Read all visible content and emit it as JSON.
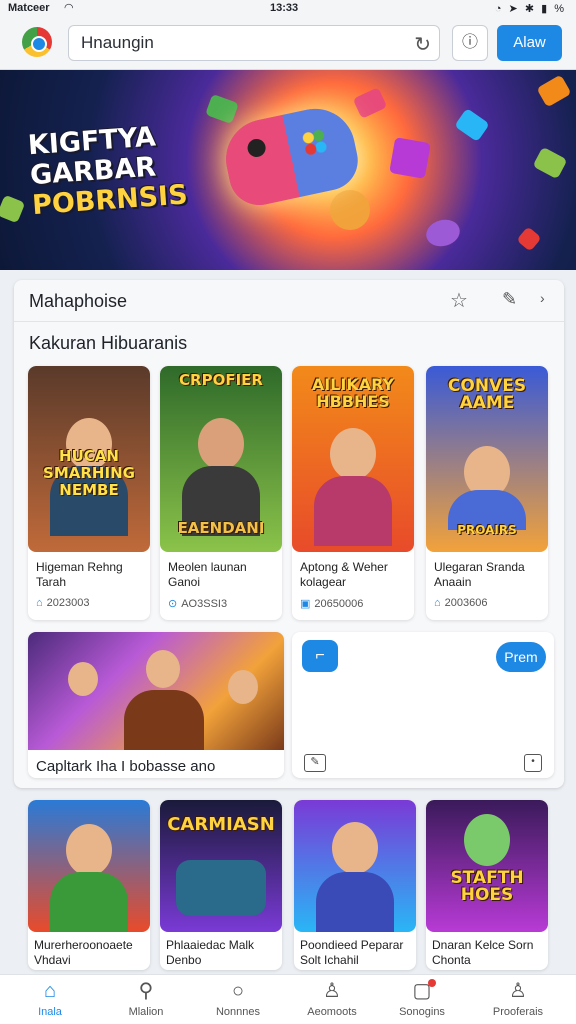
{
  "status": {
    "carrier": "Matceer",
    "time": "13:33",
    "icons": "◔ ➤ ✱ ▮ %"
  },
  "browser": {
    "url_value": "Hnaungin",
    "allow_label": "Alaw"
  },
  "hero": {
    "line1": "KIGFTYA",
    "line2": "GARBAR",
    "line3": "POBRNSIS"
  },
  "panel": {
    "title": "Mahaphoise",
    "section_title": "Kakuran Hibuaranis",
    "cards": [
      {
        "art_text": "HUCAN SMARHING NEMBE",
        "name": "Higeman Rehng Tarah",
        "meta": "2023003",
        "colors": [
          "#5a3a2a",
          "#c06a3a"
        ]
      },
      {
        "art_text": "CRPOFIER",
        "art_text2": "EAENDANI",
        "name": "Meolen launan Ganoi",
        "meta": "AO3SSI3",
        "colors": [
          "#2f6a2a",
          "#8bc34a"
        ]
      },
      {
        "art_text": "AILIKARY HBBHES",
        "name": "Aptong & Weher kolagear",
        "meta": "20650006",
        "colors": [
          "#f28a1a",
          "#e84b2a"
        ]
      },
      {
        "art_text": "CONVES AAME",
        "art_text2": "PROAIRS",
        "name": "Ulegaran Sranda Anaain",
        "meta": "2003606",
        "colors": [
          "#3a5ad6",
          "#f2a23a"
        ]
      }
    ],
    "feature_caption": "Capltark Iha I bobasse ano",
    "premium_label": "Prem"
  },
  "bottom_cards": [
    {
      "name": "Murerheroonoaete Vhdavi",
      "colors": [
        "#2a7ad6",
        "#e84b2a"
      ]
    },
    {
      "art_text": "CARMIASN",
      "name": "Phlaaiedac Malk Denbo",
      "colors": [
        "#1a1a3a",
        "#7a3ad6"
      ]
    },
    {
      "name": "Poondieed Peparar Solt Ichahil",
      "colors": [
        "#7a3ad6",
        "#29b6f6"
      ]
    },
    {
      "art_text": "STAFTH HOES",
      "name": "Dnaran Kelce Sorn Chonta",
      "colors": [
        "#3a1a5a",
        "#b83ad6"
      ]
    }
  ],
  "nav": [
    {
      "icon": "home-icon",
      "label": "Inala"
    },
    {
      "icon": "search-icon",
      "label": "Mlalion"
    },
    {
      "icon": "chat-icon",
      "label": "Nonnnes"
    },
    {
      "icon": "user-pin-icon",
      "label": "Aeomoots"
    },
    {
      "icon": "notification-icon",
      "label": "Sonogins"
    },
    {
      "icon": "profile-icon",
      "label": "Prooferais"
    }
  ],
  "accent": "#1e88e5"
}
